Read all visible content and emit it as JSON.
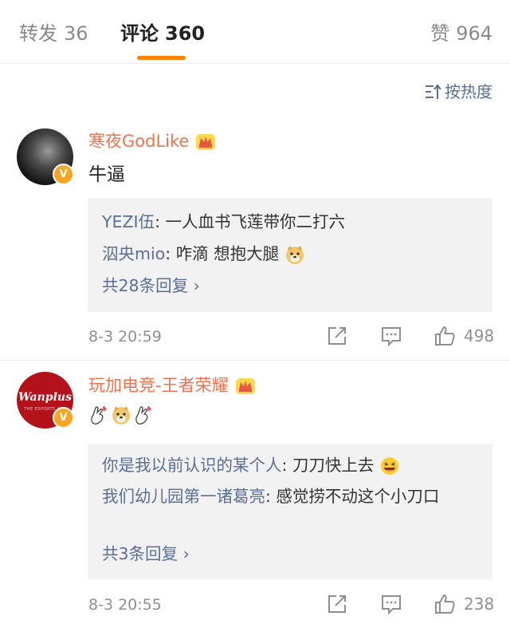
{
  "tabs": {
    "repost_label": "转发",
    "repost_count": "36",
    "comment_label": "评论",
    "comment_count": "360",
    "like_label": "赞",
    "like_count": "964"
  },
  "sort": {
    "label": "按热度",
    "icon": "sort-icon"
  },
  "comments": [
    {
      "username": "寒夜GodLike",
      "text": "牛逼",
      "replies": [
        {
          "user": "YEZI伍",
          "text": ": 一人血书飞莲带你二打六"
        },
        {
          "user": "泅央mio",
          "text": ": 咋滴 想抱大腿"
        }
      ],
      "more": "共28条回复 ",
      "time": "8-3 20:59",
      "likes": "498"
    },
    {
      "username": "玩加电竞-王者荣耀",
      "avatar_text": "Wanplus",
      "avatar_subtext": "THE ESPORTS APP",
      "replies": [
        {
          "user": "你是我以前认识的某个人",
          "text": ": 刀刀快上去"
        },
        {
          "user": "我们幼儿园第一诸葛亮",
          "text": ": 感觉捞不动这个小刀口"
        }
      ],
      "more": "共3条回复 ",
      "time": "8-3 20:55",
      "likes": "238"
    }
  ],
  "colors": {
    "accent": "#ff8200",
    "username": "#eb7350",
    "link": "#5a6f93",
    "verified": "#f5a623"
  }
}
